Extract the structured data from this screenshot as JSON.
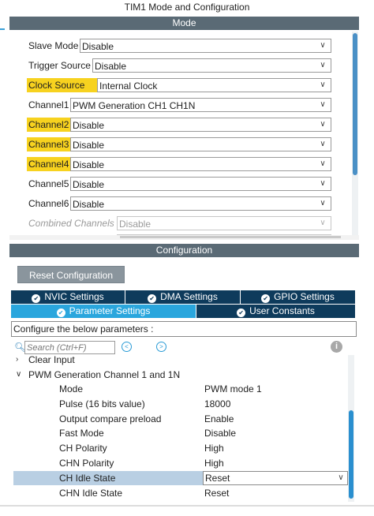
{
  "window_title": "TIM1 Mode and Configuration",
  "mode_header": "Mode",
  "mode_rows": [
    {
      "label": "Slave Mode",
      "value": "Disable",
      "highlight": false,
      "disabled": false
    },
    {
      "label": "Trigger Source",
      "value": "Disable",
      "highlight": false,
      "disabled": false
    },
    {
      "label": "Clock Source",
      "value": "Internal Clock",
      "highlight": true,
      "disabled": false
    },
    {
      "label": "Channel1",
      "value": "PWM Generation CH1 CH1N",
      "highlight": false,
      "disabled": false
    },
    {
      "label": "Channel2",
      "value": "Disable",
      "highlight": true,
      "disabled": false
    },
    {
      "label": "Channel3",
      "value": "Disable",
      "highlight": true,
      "disabled": false
    },
    {
      "label": "Channel4",
      "value": "Disable",
      "highlight": true,
      "disabled": false
    },
    {
      "label": "Channel5",
      "value": "Disable",
      "highlight": false,
      "disabled": false
    },
    {
      "label": "Channel6",
      "value": "Disable",
      "highlight": false,
      "disabled": false
    },
    {
      "label": "Combined Channels",
      "value": "Disable",
      "highlight": false,
      "disabled": true
    }
  ],
  "config_header": "Configuration",
  "reset_button": "Reset Configuration",
  "tabs": {
    "nvic": "NVIC Settings",
    "dma": "DMA Settings",
    "gpio": "GPIO Settings",
    "parameter": "Parameter Settings",
    "user_constants": "User Constants"
  },
  "params_title": "Configure the below parameters :",
  "search_placeholder": "Search (Ctrl+F)",
  "tree": {
    "clear_input": "Clear Input",
    "group": "PWM Generation Channel 1 and 1N",
    "params": [
      {
        "name": "Mode",
        "value": "PWM mode 1"
      },
      {
        "name": "Pulse (16 bits value)",
        "value": "18000"
      },
      {
        "name": "Output compare preload",
        "value": "Enable"
      },
      {
        "name": "Fast Mode",
        "value": "Disable"
      },
      {
        "name": "CH Polarity",
        "value": "High"
      },
      {
        "name": "CHN Polarity",
        "value": "High"
      },
      {
        "name": "CH Idle State",
        "value": "Reset"
      },
      {
        "name": "CHN Idle State",
        "value": "Reset"
      }
    ]
  },
  "colors": {
    "highlight": "#f7d21f",
    "tab_dark": "#0e3b5c",
    "tab_active": "#2aa6dd",
    "header_bar": "#5a6a75",
    "selected_row": "#b9cfe3"
  }
}
